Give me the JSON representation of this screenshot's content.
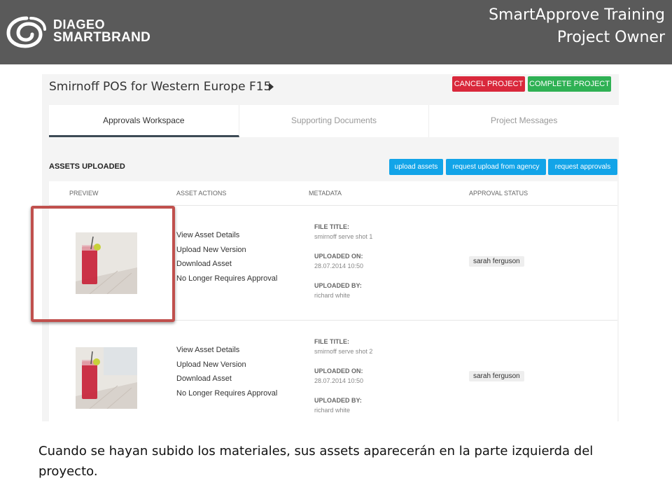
{
  "banner": {
    "logo_line1": "DIAGEO",
    "logo_line2": "SMARTBRAND",
    "title_line1": "SmartApprove Training",
    "title_line2": "Project Owner",
    "bg_color": "#5a5a5a"
  },
  "project": {
    "title": "Smirnoff POS for Western Europe F15",
    "cancel_label": "CANCEL PROJECT",
    "complete_label": "COMPLETE PROJECT",
    "cancel_color": "#d9283b",
    "complete_color": "#2fb154"
  },
  "tabs": [
    {
      "label": "Approvals Workspace",
      "active": true
    },
    {
      "label": "Supporting Documents",
      "active": false
    },
    {
      "label": "Project Messages",
      "active": false
    }
  ],
  "assets": {
    "section_label": "ASSETS UPLOADED",
    "buttons": [
      "upload assets",
      "request upload from agency",
      "request approvals"
    ],
    "button_color": "#12a4e8",
    "columns": [
      "PREVIEW",
      "ASSET ACTIONS",
      "METADATA",
      "APPROVAL STATUS"
    ],
    "rows": [
      {
        "actions": [
          "View Asset Details",
          "Upload New Version",
          "Download Asset",
          "No Longer Requires Approval"
        ],
        "file_title_label": "FILE TITLE:",
        "file_title": "smirnoff serve shot 1",
        "uploaded_on_label": "UPLOADED ON:",
        "uploaded_on": "28.07.2014 10:50",
        "uploaded_by_label": "UPLOADED BY:",
        "uploaded_by": "richard white",
        "approver": "sarah ferguson"
      },
      {
        "actions": [
          "View Asset Details",
          "Upload New Version",
          "Download Asset",
          "No Longer Requires Approval"
        ],
        "file_title_label": "FILE TITLE:",
        "file_title": "smirnoff serve shot 2",
        "uploaded_on_label": "UPLOADED ON:",
        "uploaded_on": "28.07.2014 10:50",
        "uploaded_by_label": "UPLOADED BY:",
        "uploaded_by": "richard white",
        "approver": "sarah ferguson"
      }
    ]
  },
  "highlight_color": "#c0504d",
  "caption": "Cuando se hayan subido los materiales, sus assets aparecerán en la parte izquierda del proyecto."
}
